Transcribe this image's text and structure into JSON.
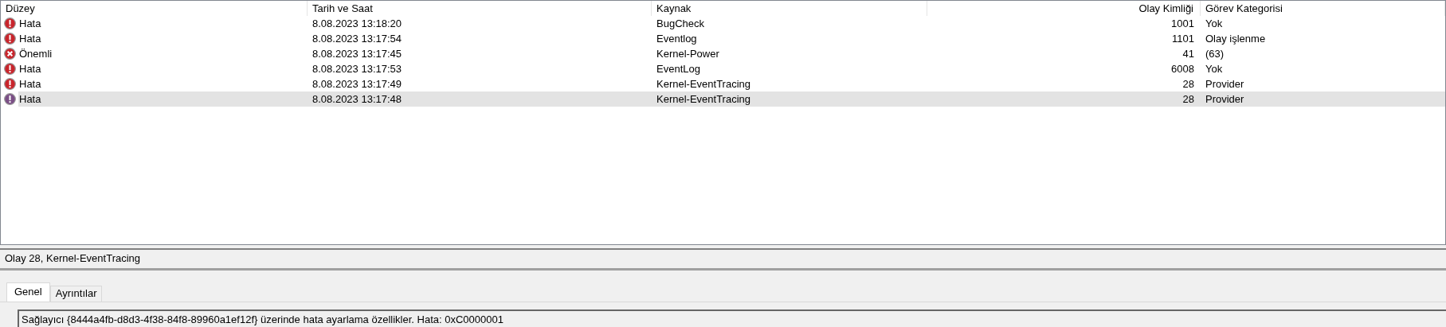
{
  "table": {
    "columns": [
      "Düzey",
      "Tarih ve Saat",
      "Kaynak",
      "Olay Kimliği",
      "Görev Kategorisi"
    ],
    "rows": [
      {
        "kind": "error",
        "level": "Hata",
        "date": "8.08.2023 13:18:20",
        "source": "BugCheck",
        "event_id": "1001",
        "category": "Yok",
        "selected": false
      },
      {
        "kind": "error",
        "level": "Hata",
        "date": "8.08.2023 13:17:54",
        "source": "Eventlog",
        "event_id": "1101",
        "category": "Olay işlenme",
        "selected": false
      },
      {
        "kind": "critical",
        "level": "Önemli",
        "date": "8.08.2023 13:17:45",
        "source": "Kernel-Power",
        "event_id": "41",
        "category": "(63)",
        "selected": false
      },
      {
        "kind": "error",
        "level": "Hata",
        "date": "8.08.2023 13:17:53",
        "source": "EventLog",
        "event_id": "6008",
        "category": "Yok",
        "selected": false
      },
      {
        "kind": "error",
        "level": "Hata",
        "date": "8.08.2023 13:17:49",
        "source": "Kernel-EventTracing",
        "event_id": "28",
        "category": "Provider",
        "selected": false
      },
      {
        "kind": "error",
        "level": "Hata",
        "date": "8.08.2023 13:17:48",
        "source": "Kernel-EventTracing",
        "event_id": "28",
        "category": "Provider",
        "selected": true
      }
    ]
  },
  "details": {
    "title": "Olay 28, Kernel-EventTracing",
    "tabs": [
      {
        "label": "Genel",
        "selected": true
      },
      {
        "label": "Ayrıntılar",
        "selected": false
      }
    ],
    "description": "Sağlayıcı {8444a4fb-d8d3-4f38-84f8-89960a1ef12f} üzerinde hata ayarlama özellikler. Hata: 0xC0000001"
  }
}
